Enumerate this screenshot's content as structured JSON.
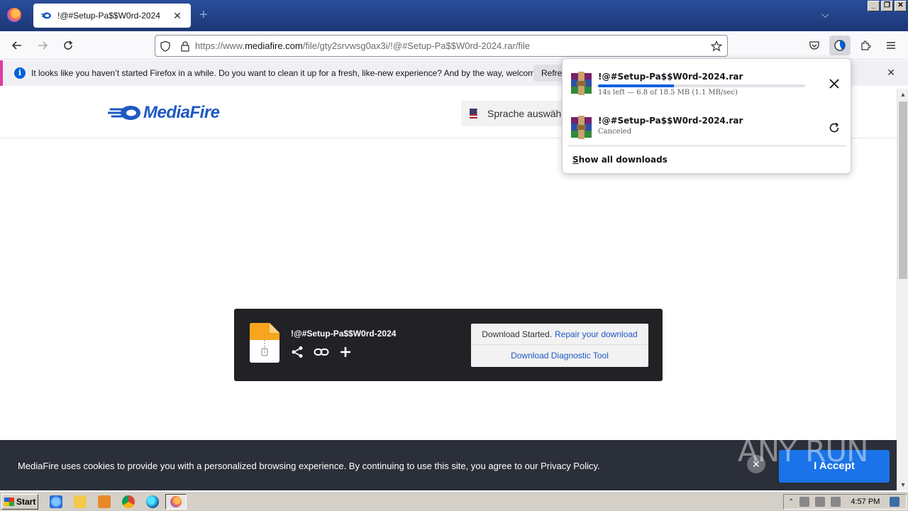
{
  "browser": {
    "tab_title": "!@#Setup-Pa$$W0rd-2024",
    "url_prefix": "https://www.",
    "url_domain": "mediafire.com",
    "url_path": "/file/gty2srvwsg0ax3i/!@#Setup-Pa$$W0rd-2024.rar/file"
  },
  "notification": {
    "text": "It looks like you haven’t started Firefox in a while. Do you want to clean it up for a fresh, like-new experience? And by the way, welcome back!",
    "button_label": "Refresh"
  },
  "downloads": {
    "items": [
      {
        "name": "!@#Setup-Pa$$W0rd-2024.rar",
        "status": "14s left — 6.8 of 18.5 MB (1.1 MB/sec)",
        "progress_percent": 36.8,
        "action_icon": "close-icon"
      },
      {
        "name": "!@#Setup-Pa$$W0rd-2024.rar",
        "status": "Canceled",
        "action_icon": "retry-icon"
      }
    ],
    "show_all_label_prefix": "S",
    "show_all_label_rest": "how all downloads"
  },
  "page": {
    "logo_text": "MediaFire",
    "language_label": "Sprache auswählen",
    "file_name": "!@#Setup-Pa$$W0rd-2024",
    "download_started": "Download Started.",
    "repair_link": "Repair your download",
    "diagnostic_tool": "Download Diagnostic Tool",
    "cookie_text": "MediaFire uses cookies to provide you with a personalized browsing experience. By continuing to use this site, you agree to our Privacy Policy.",
    "accept_label": "I Accept",
    "watermark": "ANY RUN"
  },
  "taskbar": {
    "start_label": "Start",
    "clock": "4:57 PM"
  },
  "colors": {
    "accent": "#0060df",
    "mediafire_blue": "#1e58c4",
    "cookie_bar": "#2b2f39",
    "accept_button": "#1a73e8"
  }
}
